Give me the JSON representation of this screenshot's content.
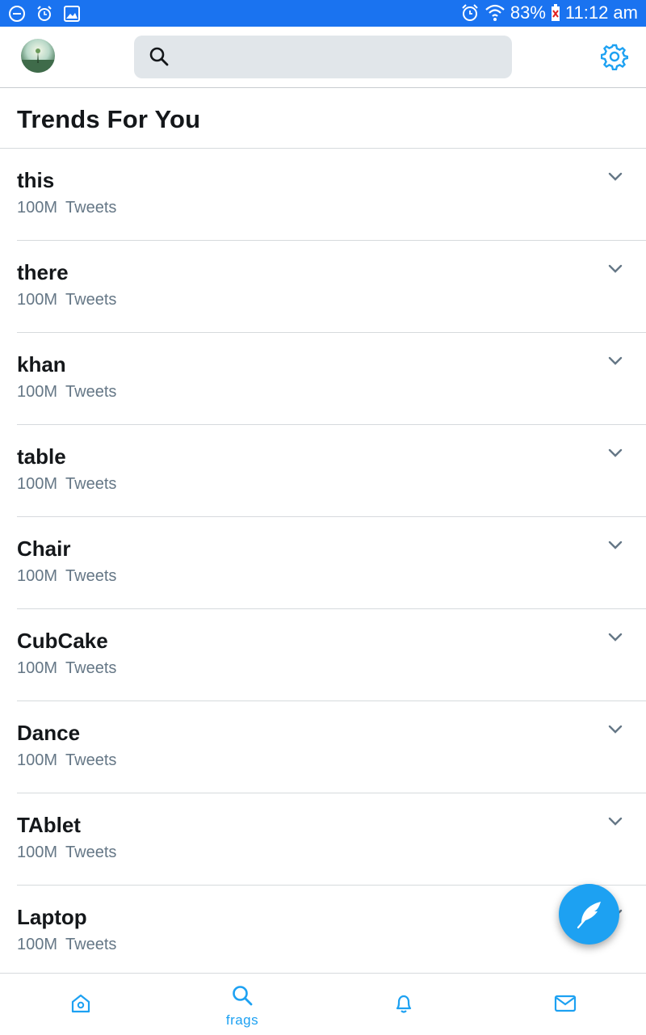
{
  "status_bar": {
    "battery": "83%",
    "time": "11:12 am"
  },
  "search": {
    "placeholder": ""
  },
  "heading": "Trends For You",
  "trends": [
    {
      "name": "this",
      "count": "100M",
      "unit": "Tweets"
    },
    {
      "name": "there",
      "count": "100M",
      "unit": "Tweets"
    },
    {
      "name": "khan",
      "count": "100M",
      "unit": "Tweets"
    },
    {
      "name": "table",
      "count": "100M",
      "unit": "Tweets"
    },
    {
      "name": "Chair",
      "count": "100M",
      "unit": "Tweets"
    },
    {
      "name": "CubCake",
      "count": "100M",
      "unit": "Tweets"
    },
    {
      "name": "Dance",
      "count": "100M",
      "unit": "Tweets"
    },
    {
      "name": "TAblet",
      "count": "100M",
      "unit": "Tweets"
    },
    {
      "name": "Laptop",
      "count": "100M",
      "unit": "Tweets"
    }
  ],
  "bottom_nav": {
    "active_label": "frags",
    "items": [
      "home-icon",
      "search-icon",
      "bell-icon",
      "mail-icon"
    ]
  },
  "colors": {
    "status_bar": "#1a73f0",
    "accent": "#1da1f2",
    "secondary_text": "#657786"
  }
}
